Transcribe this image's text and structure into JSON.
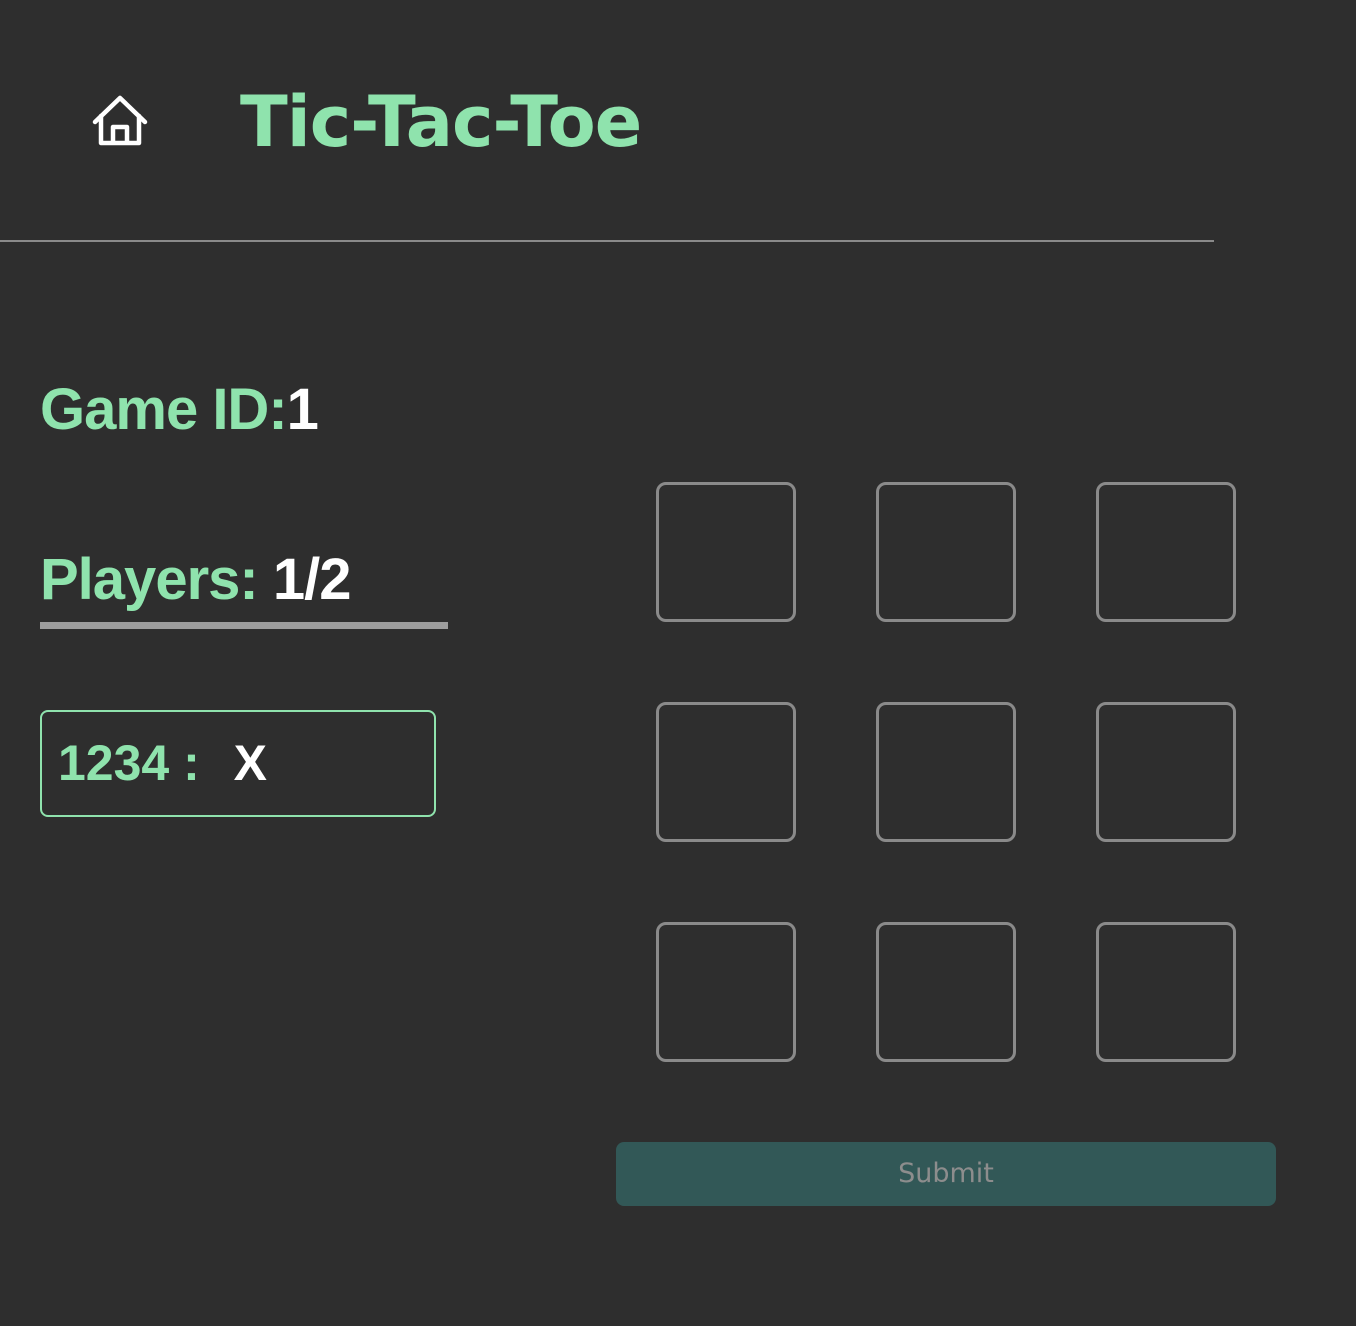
{
  "header": {
    "home_icon": "home-icon",
    "title": "Tic-Tac-Toe"
  },
  "game": {
    "id_label": "Game ID:",
    "id_value": "1"
  },
  "players": {
    "label": "Players: ",
    "count": "1/2",
    "list": [
      {
        "id": "1234",
        "separator": " : ",
        "symbol": "X"
      }
    ]
  },
  "board": {
    "cells": [
      "",
      "",
      "",
      "",
      "",
      "",
      "",
      "",
      ""
    ]
  },
  "actions": {
    "submit_label": "Submit"
  },
  "colors": {
    "background": "#2e2e2e",
    "accent": "#8fe3ad",
    "cell_border": "#8a8a8a",
    "submit_background": "#325857",
    "submit_text": "#8d8d8d"
  }
}
